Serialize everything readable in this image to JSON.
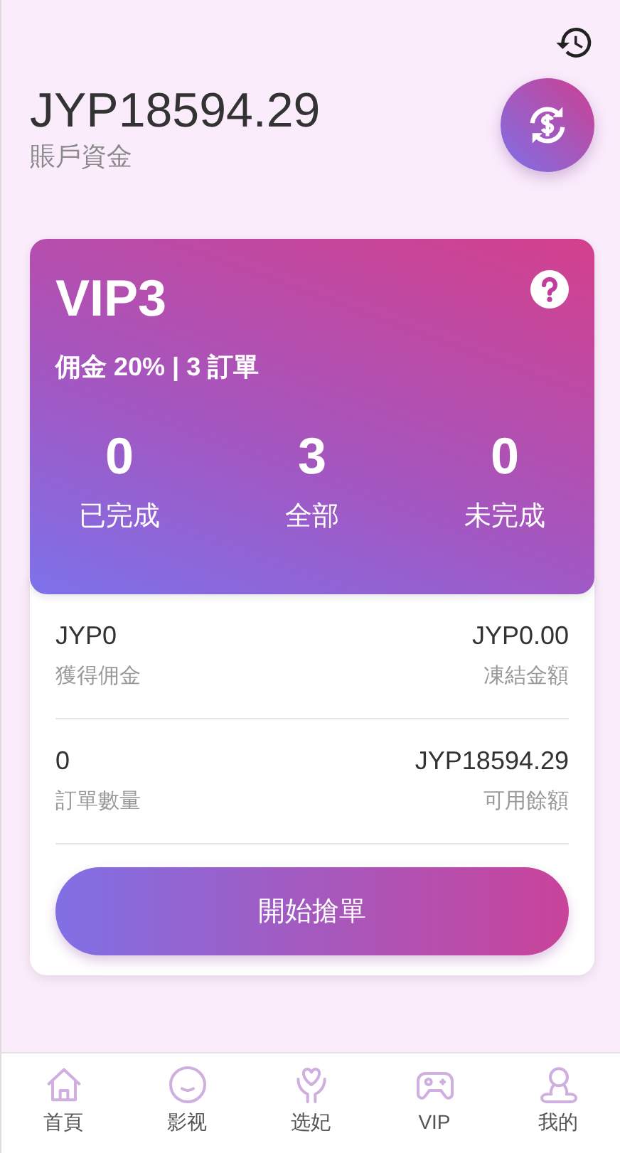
{
  "balance": {
    "amount": "JYP18594.29",
    "label": "賬戶資金"
  },
  "vip": {
    "title": "VIP3",
    "summary": "佣金 20% | 3 訂單",
    "stats": [
      {
        "value": "0",
        "label": "已完成"
      },
      {
        "value": "3",
        "label": "全部"
      },
      {
        "value": "0",
        "label": "未完成"
      }
    ]
  },
  "details": [
    [
      {
        "value": "JYP0",
        "label": "獲得佣金"
      },
      {
        "value": "JYP0.00",
        "label": "凍結金額"
      }
    ],
    [
      {
        "value": "0",
        "label": "訂單數量"
      },
      {
        "value": "JYP18594.29",
        "label": "可用餘額"
      }
    ]
  ],
  "start_button": "開始搶單",
  "nav": [
    {
      "kind": "home",
      "label": "首頁"
    },
    {
      "kind": "smile",
      "label": "影视"
    },
    {
      "kind": "heart",
      "label": "选妃"
    },
    {
      "kind": "gamepad",
      "label": "VIP"
    },
    {
      "kind": "user",
      "label": "我的"
    }
  ]
}
